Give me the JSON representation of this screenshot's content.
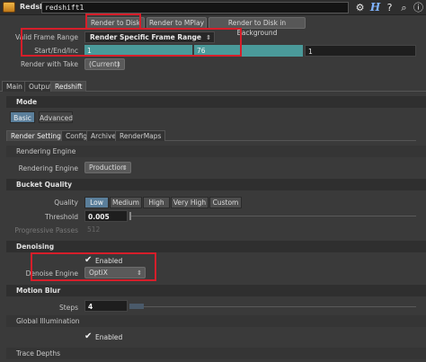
{
  "header": {
    "node_type": "Redshift",
    "node_name": "redshift1",
    "icons": [
      "gear-icon",
      "h-icon",
      "help-icon",
      "search-icon",
      "info-icon"
    ],
    "h_label": "H"
  },
  "render_buttons": {
    "render_to_disk": "Render to Disk",
    "render_to_mplay": "Render to MPlay",
    "render_bg": "Render to Disk in Background"
  },
  "params": {
    "valid_frame_range_label": "Valid Frame Range",
    "valid_frame_range_value": "Render Specific Frame Range",
    "start_end_inc_label": "Start/End/Inc",
    "start": "1",
    "end": "76",
    "inc": "1",
    "render_with_take_label": "Render with Take",
    "render_with_take_value": "(Current)"
  },
  "main_tabs": [
    "Main",
    "Output",
    "Redshift"
  ],
  "mode": {
    "title": "Mode",
    "tabs": [
      "Basic",
      "Advanced"
    ]
  },
  "sub_tabs": [
    "Render Settings",
    "Config",
    "Archive",
    "RenderMaps"
  ],
  "rendering_engine": {
    "section": "Rendering Engine",
    "label": "Rendering Engine",
    "value": "Production"
  },
  "bucket_quality": {
    "section": "Bucket Quality",
    "quality_label": "Quality",
    "quality_options": [
      "Low",
      "Medium",
      "High",
      "Very High",
      "Custom"
    ],
    "threshold_label": "Threshold",
    "threshold_value": "0.005",
    "progressive_label": "Progressive Passes",
    "progressive_value": "512"
  },
  "denoising": {
    "section": "Denoising",
    "enabled_label": "Enabled",
    "engine_label": "Denoise Engine",
    "engine_value": "OptiX"
  },
  "motion_blur": {
    "section": "Motion Blur",
    "steps_label": "Steps",
    "steps_value": "4"
  },
  "global_illumination": {
    "section": "Global Illumination",
    "enabled_label": "Enabled"
  },
  "trace_depths": {
    "section": "Trace Depths"
  },
  "colors": {
    "accent_teal": "#4a9a9a",
    "highlight_red": "#d61e2a",
    "selected_blue": "#5a7e9a"
  }
}
